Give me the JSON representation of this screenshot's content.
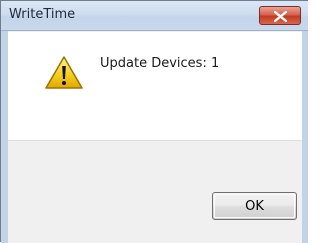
{
  "window": {
    "title": "WriteTime"
  },
  "message": {
    "text": "Update Devices: 1",
    "icon": "warning-icon"
  },
  "buttons": {
    "ok_label": "OK"
  },
  "colors": {
    "titlebar": "#cddcef",
    "close_button": "#c23a22",
    "warning_yellow": "#f5c400"
  }
}
